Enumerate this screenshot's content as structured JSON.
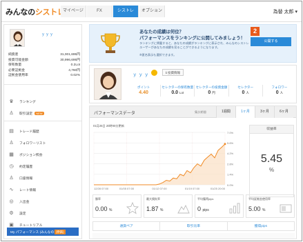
{
  "brand": {
    "logo_main": "みんなの",
    "logo_accent": "シストレ"
  },
  "nav": {
    "tabs": [
      {
        "label": "マイページ"
      },
      {
        "label": "FX"
      },
      {
        "label": "シストレ"
      },
      {
        "label": "オプション"
      }
    ],
    "active_index": 2
  },
  "user": {
    "name_display": "為替 太郎 ▾"
  },
  "sidebar": {
    "username": "ｙｙｙ",
    "stats": [
      {
        "label": "純資産",
        "value": "31,001,695円"
      },
      {
        "label": "投資可能金額",
        "value": "30,996,695円"
      },
      {
        "label": "保有数量",
        "value": "0.2Lot"
      },
      {
        "label": "必要証拠金",
        "value": "4,760円"
      },
      {
        "label": "証拠金使用率",
        "value": "0.02%"
      }
    ],
    "menu_top": [
      {
        "label": "ランキング",
        "icon": "trophy-icon"
      },
      {
        "label": "取引設定",
        "badge": "NEW",
        "icon": "user-icon"
      }
    ],
    "menu": [
      {
        "label": "トレード履歴",
        "icon": "list-icon"
      },
      {
        "label": "フォロワーリスト",
        "icon": "person-icon"
      },
      {
        "label": "ポジション照会",
        "icon": "grid-icon"
      },
      {
        "label": "約定履歴",
        "icon": "clock-icon"
      },
      {
        "label": "口座情報",
        "icon": "account-icon"
      },
      {
        "label": "レート情報",
        "icon": "wave-icon"
      },
      {
        "label": "入出金",
        "icon": "yen-icon"
      },
      {
        "label": "設定",
        "icon": "gear-icon"
      },
      {
        "label": "チュートリアル",
        "icon": "book-icon"
      }
    ],
    "bottom_label": "My パフォーマンス",
    "bottom_label_b": "(みんなの",
    "bottom_highlight": "評価)"
  },
  "banner": {
    "title_line1": "あなたの成績は何位？",
    "title_line2": "パフォーマンスをランキングに公開してみましょう！",
    "desc": "ランキングに掲載すると、あなたの成績がランキングに表示され、みんなのシストレユーザーがあなたの成績を見ることができるようになります。",
    "note": "※匿名表示も選択できます。",
    "step_number": "2",
    "button_label": "公開する"
  },
  "profile": {
    "username": "ｙｙｙ",
    "invest_button": "投資情報",
    "stats": [
      {
        "label": "ポイント",
        "value": "4.40",
        "unit": "",
        "highlight": true
      },
      {
        "label": "セレクターの保有数量",
        "value": "0.0",
        "unit": "Lot"
      },
      {
        "label": "セレクターの投資金額",
        "value": "0",
        "unit": "円"
      },
      {
        "label": "セレクター",
        "value": "0",
        "unit": "人"
      },
      {
        "label": "フォロワー",
        "value": "0",
        "unit": "人"
      }
    ]
  },
  "performance": {
    "title": "パフォーマンスデータ",
    "updated": "集計期間",
    "period_tabs": [
      "1週間",
      "1ヶ月",
      "3ヶ月",
      "6ヶ月"
    ],
    "active_period": 1,
    "chart_date": "01月25日 20時00分更新",
    "return_label": "収益率",
    "return_value": "5.45",
    "return_unit": "%",
    "metrics": [
      {
        "label": "勝率",
        "value": "0.00",
        "unit": "%",
        "icon": "star-icon"
      },
      {
        "label": "最大損失率",
        "value": "1.87",
        "unit": "%",
        "icon": "mountain-icon"
      },
      {
        "label": "平均獲得pips",
        "value": "0",
        "unit": "pips",
        "icon": "bars-icon"
      },
      {
        "label": "平均証拠金使用率",
        "value": "5.00",
        "unit": "%",
        "icon": "ratio-icon"
      }
    ],
    "bottom_tabs": [
      "通貨ペア",
      "取引比率",
      "獲得pips"
    ]
  },
  "chart_data": {
    "type": "line",
    "x": [
      "12/28 07:00",
      "01/05 07:00",
      "01/12 07:00",
      "01/19 07:00",
      "01/25 20:00"
    ],
    "values": [
      0,
      0,
      0,
      0,
      0,
      0,
      0,
      0,
      0,
      0,
      0,
      0,
      0,
      0,
      0,
      0,
      0,
      0,
      0,
      0.1,
      0.3,
      0.6,
      0.5,
      0.9,
      0.8,
      1.4,
      1.2,
      1.9,
      1.6,
      2.3,
      2.8,
      2.5,
      3.3,
      3.7,
      4.1,
      3.6,
      4.6,
      5.0,
      5.45
    ],
    "y_ticks": [
      "7.0%",
      "5.6%",
      "4.2%",
      "2.8%",
      "1.4%",
      "0.0%"
    ],
    "ylim": [
      0,
      7
    ],
    "colors": {
      "line": "#f08a24",
      "fill": "#fbe0c4",
      "grid": "#e6e6e6",
      "accent": "#2a8ad8"
    }
  }
}
